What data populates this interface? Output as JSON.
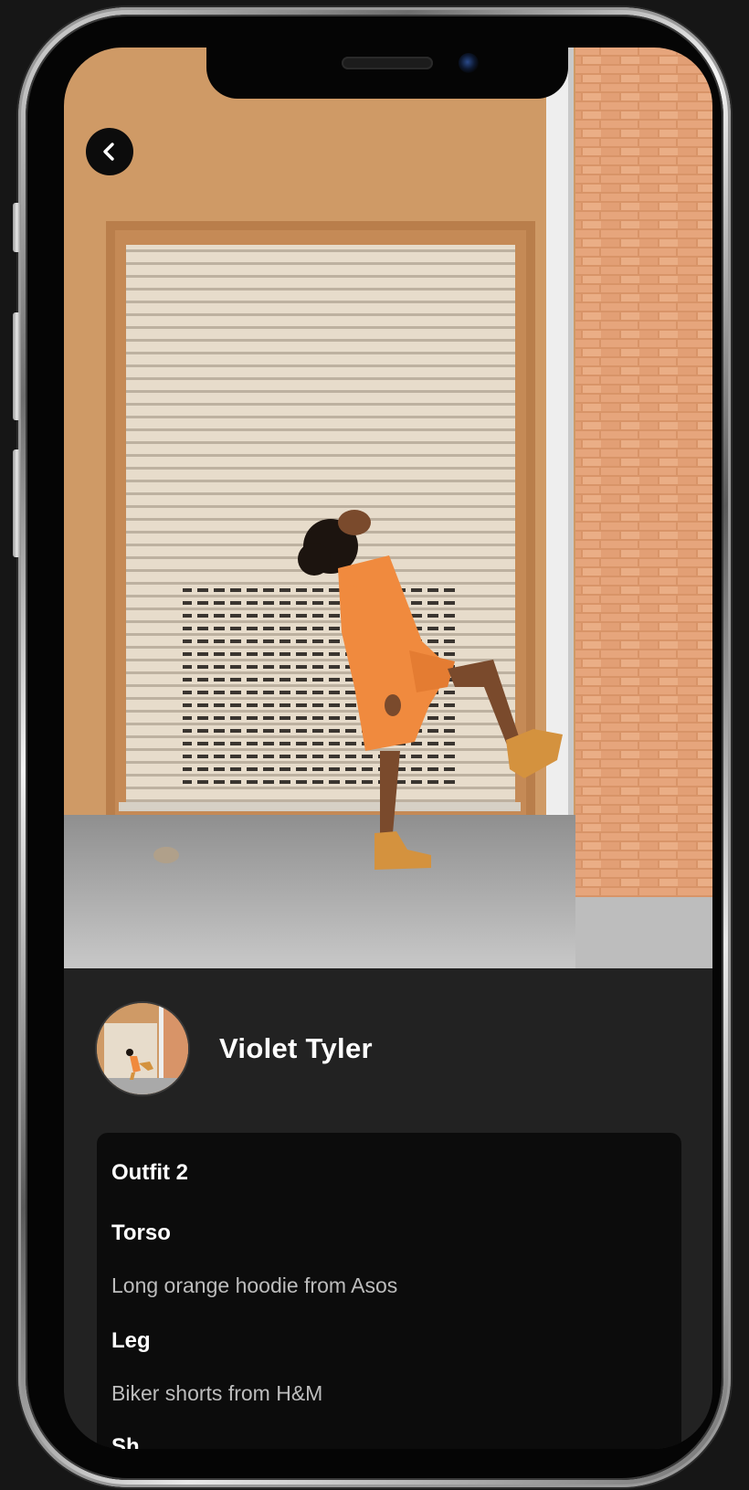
{
  "header": {
    "back_icon": "chevron-left-icon"
  },
  "profile": {
    "name": "Violet Tyler"
  },
  "outfit": {
    "title": "Outfit 2",
    "sections": [
      {
        "heading": "Torso",
        "value": "Long orange hoodie from Asos"
      },
      {
        "heading": "Leg",
        "value": "Biker shorts from H&M"
      },
      {
        "heading": "Sh",
        "value": ""
      }
    ]
  },
  "colors": {
    "background": "#161616",
    "screen": "#222222",
    "card": "#0c0c0c",
    "text_primary": "#ffffff",
    "text_secondary": "#bdbdbd",
    "outfit_orange": "#f08a3e"
  }
}
